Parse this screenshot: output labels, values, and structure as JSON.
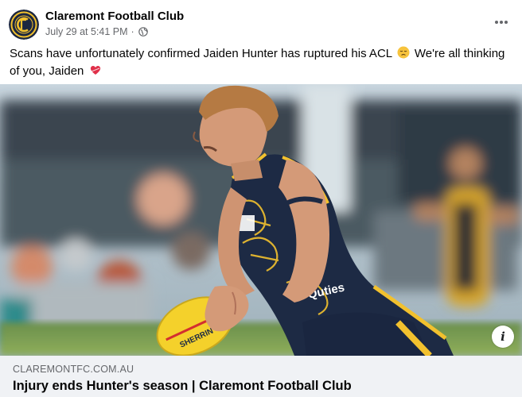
{
  "post": {
    "page_name": "Claremont Football Club",
    "timestamp": "July 29 at 5:41 PM",
    "separator": "·",
    "privacy_icon": "globe-icon",
    "more_icon": "more-options-icon",
    "text_main": "Scans have unfortunately confirmed Jaiden Hunter has ruptured his ACL",
    "emoji_1": "disappointed-face-emoji",
    "text_tail": "We're all thinking of you, Jaiden",
    "emoji_2": "heart-emoji"
  },
  "image": {
    "info_label": "i"
  },
  "link": {
    "domain": "CLAREMONTFC.COM.AU",
    "title": "Injury ends Hunter's season | Claremont Football Club"
  },
  "colors": {
    "text_primary": "#050505",
    "text_secondary": "#65676b",
    "link_bg": "#f0f2f5",
    "club_navy": "#1c2740",
    "club_gold": "#f2c12e"
  }
}
